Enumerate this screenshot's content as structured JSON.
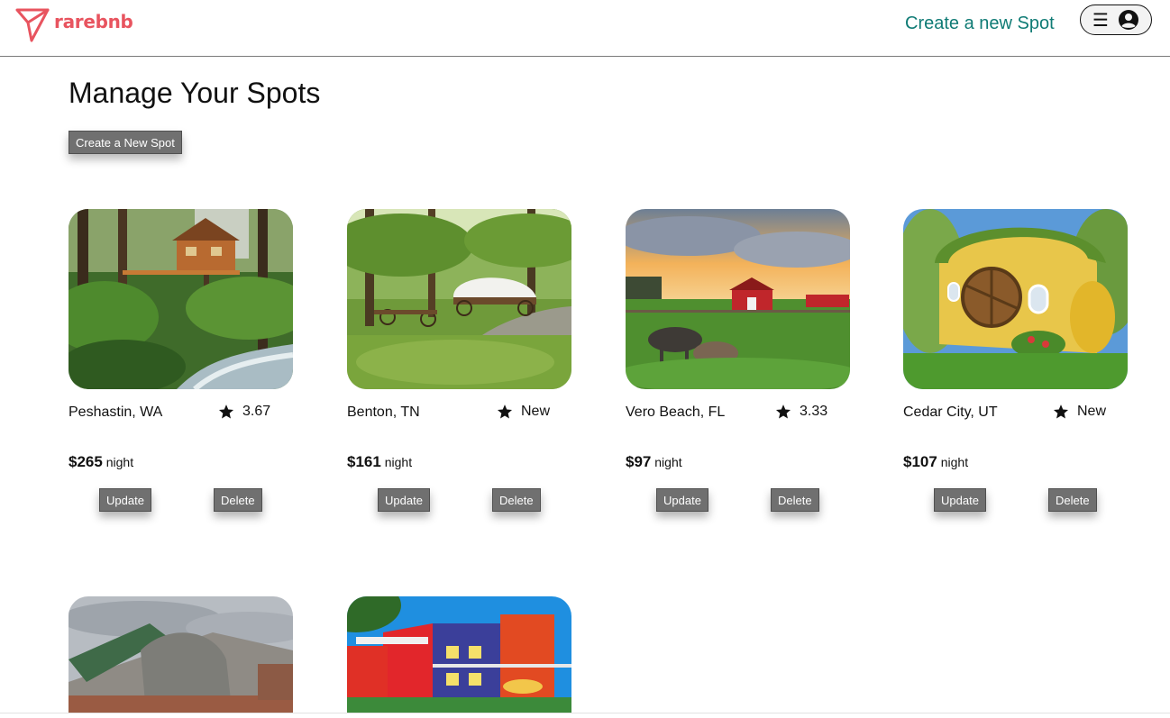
{
  "header": {
    "logo_text": "rarebnb",
    "create_spot_link": "Create a new Spot",
    "menu_icon": "hamburger-icon",
    "profile_icon": "user-circle-icon",
    "brand_color": "#e8545f",
    "link_color": "#0f7b75"
  },
  "main": {
    "title": "Manage Your Spots",
    "create_button": "Create a New Spot"
  },
  "spots": [
    {
      "location": "Peshastin, WA",
      "rating": "3.67",
      "price": "$265",
      "price_unit": "night",
      "update_label": "Update",
      "delete_label": "Delete",
      "image": "treehouse by river in forest"
    },
    {
      "location": "Benton, TN",
      "rating": "New",
      "price": "$161",
      "price_unit": "night",
      "update_label": "Update",
      "delete_label": "Delete",
      "image": "covered wagon under trees"
    },
    {
      "location": "Vero Beach, FL",
      "rating": "3.33",
      "price": "$97",
      "price_unit": "night",
      "update_label": "Update",
      "delete_label": "Delete",
      "image": "farm with red barn and donkeys at sunset"
    },
    {
      "location": "Cedar City, UT",
      "rating": "New",
      "price": "$107",
      "price_unit": "night",
      "update_label": "Update",
      "delete_label": "Delete",
      "image": "hobbit house with grass roof"
    },
    {
      "image": "earthship home in desert"
    },
    {
      "image": "colorful modern apartment building"
    }
  ],
  "icons": {
    "rating": "star-icon"
  }
}
